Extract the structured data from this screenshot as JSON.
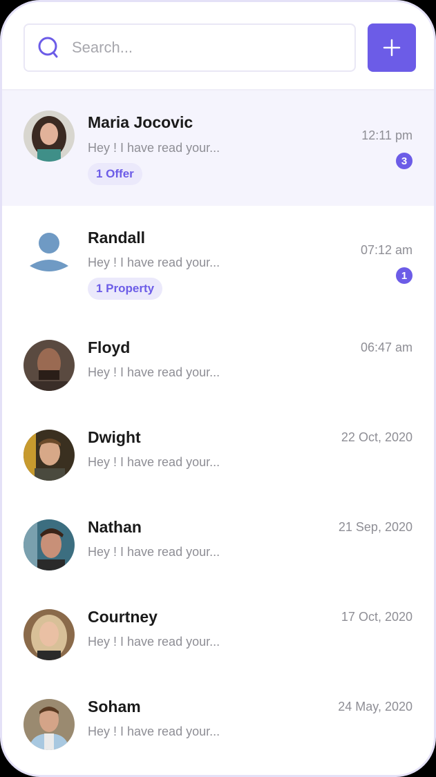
{
  "search": {
    "placeholder": "Search...",
    "icon": "search-icon"
  },
  "toolbar": {
    "add_icon": "plus-icon"
  },
  "colors": {
    "accent": "#6c5ce7",
    "chip_bg": "#ebe9fb",
    "active_row_bg": "#f5f4fd",
    "placeholder_avatar": "#6f9ac4"
  },
  "conversations": [
    {
      "name": "Maria Jocovic",
      "preview": "Hey ! I have read your...",
      "time": "12:11 pm",
      "unread": "3",
      "tag": "1 Offer",
      "avatar": "photo",
      "active": true
    },
    {
      "name": "Randall",
      "preview": "Hey ! I have read your...",
      "time": "07:12 am",
      "unread": "1",
      "tag": "1 Property",
      "avatar": "placeholder"
    },
    {
      "name": "Floyd",
      "preview": "Hey ! I have read your...",
      "time": "06:47 am",
      "avatar": "photo"
    },
    {
      "name": "Dwight",
      "preview": "Hey ! I have read your...",
      "time": "22 Oct, 2020",
      "avatar": "photo"
    },
    {
      "name": "Nathan",
      "preview": "Hey ! I have read your...",
      "time": "21 Sep, 2020",
      "avatar": "photo"
    },
    {
      "name": "Courtney",
      "preview": "Hey ! I have read your...",
      "time": "17 Oct, 2020",
      "avatar": "photo"
    },
    {
      "name": "Soham",
      "preview": "Hey ! I have read your...",
      "time": "24 May, 2020",
      "avatar": "photo"
    }
  ]
}
